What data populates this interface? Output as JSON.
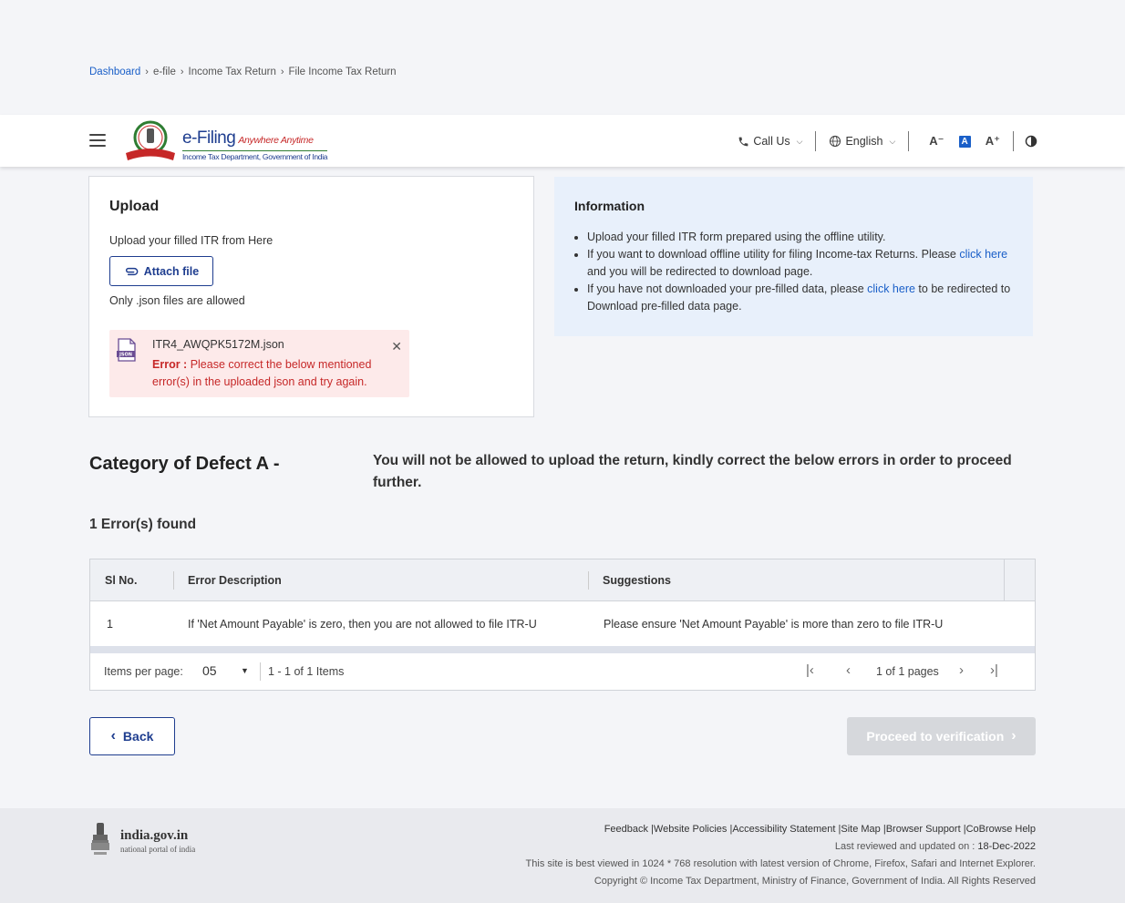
{
  "breadcrumb": [
    "Dashboard",
    "e-file",
    "Income Tax Return",
    "File Income Tax Return"
  ],
  "header": {
    "logo_title": "e-Filing",
    "logo_tagline": "Anywhere Anytime",
    "logo_subtitle": "Income Tax Department, Government of India",
    "call_us": "Call Us",
    "language": "English",
    "font_decrease": "A⁻",
    "font_normal": "A",
    "font_increase": "A⁺"
  },
  "upload": {
    "title": "Upload",
    "subtitle": "Upload your filled ITR from Here",
    "attach_label": "Attach file",
    "only_json": "Only .json files are allowed",
    "file_icon_label": "JSON",
    "file_name": "ITR4_AWQPK5172M.json",
    "error_label": "Error :",
    "error_text": "Please correct the below mentioned error(s) in the uploaded json and try again."
  },
  "information": {
    "title": "Information",
    "item1": "Upload your filled ITR form prepared using the offline utility.",
    "item2_pre": "If you want to download offline utility for filing Income-tax Returns. Please ",
    "item2_link": "click here",
    "item2_post": " and you will be redirected to download page.",
    "item3_pre": "If you have not downloaded your pre-filled data, please ",
    "item3_link": "click here",
    "item3_post": " to be redirected to Download pre-filled data page."
  },
  "defect": {
    "title": "Category of Defect A -",
    "message": "You will not be allowed to upload the return, kindly correct the below errors in order to proceed further.",
    "errors_found": "1 Error(s) found"
  },
  "table": {
    "headers": [
      "Sl No.",
      "Error Description",
      "Suggestions"
    ],
    "rows": [
      [
        "1",
        "If 'Net Amount Payable' is zero, then you are not allowed to file ITR-U",
        "Please ensure 'Net Amount Payable' is more than zero to file ITR-U"
      ]
    ],
    "items_per_page_label": "Items per page:",
    "items_per_page_value": "05",
    "range": "1 - 1 of 1 Items",
    "pages": "1 of 1 pages"
  },
  "actions": {
    "back": "Back",
    "proceed": "Proceed to verification"
  },
  "footer": {
    "logo_title": "india.gov.in",
    "logo_sub": "national portal of india",
    "links": [
      "Feedback",
      "Website Policies",
      "Accessibility Statement",
      "Site Map",
      "Browser Support",
      "CoBrowse Help"
    ],
    "last_reviewed_label": "Last reviewed and updated on : ",
    "last_reviewed_date": "18-Dec-2022",
    "best_viewed": "This site is best viewed in 1024 * 768 resolution with latest version of Chrome, Firefox, Safari and Internet Explorer.",
    "copyright": "Copyright © Income Tax Department, Ministry of Finance, Government of India. All Rights Reserved"
  },
  "colors": {
    "brand_blue": "#1e3d8f",
    "link_blue": "#1a5fc8",
    "error_red": "#c62828",
    "error_bg": "#fdeaea",
    "info_bg": "#e8f0fb"
  }
}
